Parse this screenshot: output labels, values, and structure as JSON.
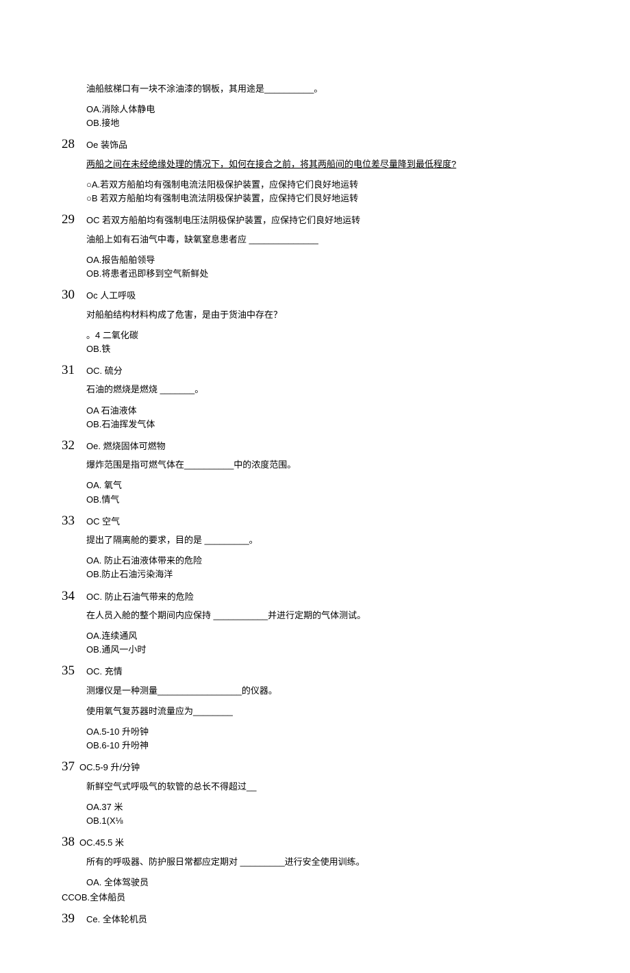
{
  "q27": {
    "stem": "油船舷梯口有一块不涂油漆的钢板，其用途是__________。",
    "a": "OA.消除人体静电",
    "b": "OB.接地"
  },
  "n28": {
    "num": "28",
    "c": "Oe 装饰品"
  },
  "q28": {
    "stem": "两船之间在未经绝缘处理的情况下，如何在接合之前，将其两船间的电位差尽量降到最低程度?",
    "a": "○A.若双方船舶均有强制电流法阳极保护装置，应保持它们良好地运转",
    "b": "○B 若双方船舶均有强制电流法阴极保护装置，应保持它们艮好地运转"
  },
  "n29": {
    "num": "29",
    "c": "OC 若双方船舶均有强制电压法阴极保护装置，应保持它们良好地运转"
  },
  "q29": {
    "stem": "油船上如有石油气中毒，缺氧窒息患者应 ______________",
    "a": "OA.报告船舶领导",
    "b": "OB.将患者迅即移到空气新鲜处"
  },
  "n30": {
    "num": "30",
    "c": "Oc 人工呼吸"
  },
  "q30": {
    "stem": "对船舶结构材料构成了危害，是由于货油中存在？",
    "a": "。4 二氧化碳",
    "b": "OB.铁"
  },
  "n31": {
    "num": "31",
    "c": "OC. 硫分"
  },
  "q31": {
    "stem": "石油的燃烧是燃烧 _______。",
    "a": "OA 石油液体",
    "b": "OB.石油挥发气体"
  },
  "n32": {
    "num": "32",
    "c": "Oe. 燃烧固体可燃物"
  },
  "q32": {
    "stem": "爆炸范围是指可燃气体在__________中的浓度范围。",
    "a": "OA. 氧气",
    "b": "OB.情气"
  },
  "n33": {
    "num": "33",
    "c": "OC 空气"
  },
  "q33": {
    "stem": "提出了隔离舱的要求，目的是 _________。",
    "a": "OA. 防止石油液体带来的危险",
    "b": "OB.防止石油污染海洋"
  },
  "n34": {
    "num": "34",
    "c": "OC. 防止石油气带来的危险"
  },
  "q34": {
    "stem": "在人员入舱的整个期间内应保持 ___________并进行定期的气体测试。",
    "a": "OA.连续通风",
    "b": "OB.通风一小时"
  },
  "n35": {
    "num": "35",
    "c": "OC. 充情"
  },
  "q35": {
    "stem": "测爆仪是一种测量_________________的仪器。"
  },
  "q36": {
    "stem": "使用氧气复苏器时流量应为________",
    "a": "OA.5-10 升吩钟",
    "b": "OB.6-10 升吩神"
  },
  "n37": {
    "num": "37",
    "c": "OC.5-9 升/分钟"
  },
  "q37": {
    "stem": "新鲜空气式呼吸气的软管的总长不得超过__",
    "a": "OA.37 米",
    "b": "OB.1(X⅛"
  },
  "n38": {
    "num": "38",
    "c": "OC.45.5 米"
  },
  "q38": {
    "stem": "所有的呼吸器、防护服日常都应定期对 _________进行安全使用训练。",
    "a": "OA. 全体驾驶员",
    "b": "CCOB.全体船员"
  },
  "n39": {
    "num": "39",
    "c": "Ce. 全体轮机员"
  }
}
